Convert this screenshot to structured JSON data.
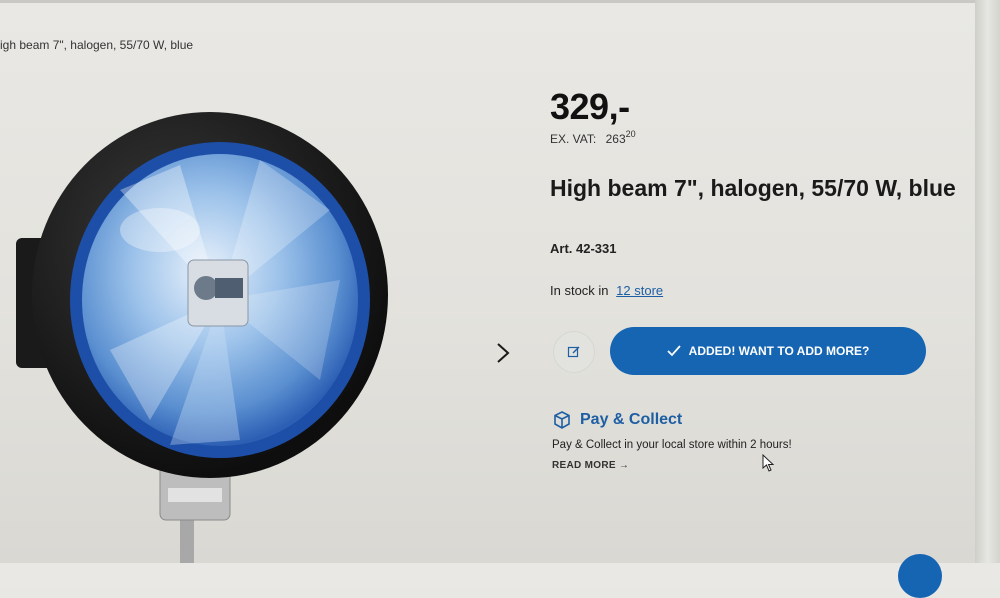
{
  "breadcrumb": {
    "text": "igh beam 7\", halogen, 55/70 W, blue"
  },
  "product": {
    "price": "329,-",
    "ex_vat_label": "EX. VAT:",
    "ex_vat_value": "263",
    "ex_vat_cents": "20",
    "title": "High beam 7\", halogen, 55/70 W, blue",
    "article": "Art. 42-331",
    "stock_text": "In stock in",
    "stock_link": "12 store"
  },
  "actions": {
    "edit_icon": "edit-icon",
    "cart_button_label": "ADDED! WANT TO ADD MORE?",
    "cart_button_icon": "check-icon",
    "next_icon": "chevron-right-icon"
  },
  "pay_collect": {
    "icon": "box-icon",
    "title": "Pay & Collect",
    "text": "Pay & Collect in your local store within 2 hours!",
    "read_more": "READ MORE →"
  },
  "colors": {
    "accent": "#1565b3",
    "link": "#1e5fa3",
    "background": "#e6e5e1"
  }
}
